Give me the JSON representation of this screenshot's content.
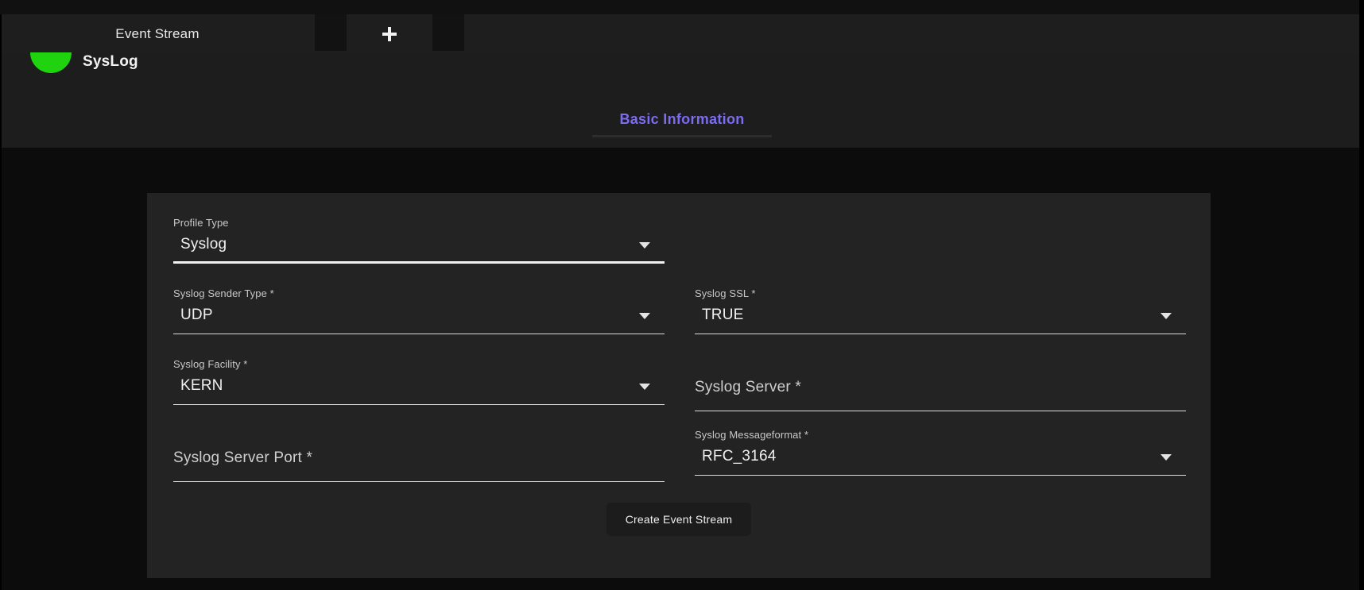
{
  "window": {
    "tab_bar": {
      "tabs": [
        {
          "label": "Event Stream",
          "name": "tab-event-stream"
        }
      ],
      "add_tab_icon": "plus-icon"
    }
  },
  "stream_header": {
    "status_icon": "half-circle-status-icon",
    "status_color": "#1fd40f",
    "name": "SysLog",
    "tabs": [
      {
        "label": "Basic Information",
        "active": true
      }
    ],
    "accent_color": "#7b6cf0"
  },
  "form": {
    "rows": [
      {
        "left": {
          "type": "select",
          "label": "Profile Type",
          "value": "Syslog",
          "filled": true,
          "caret": "chevron-down-icon"
        },
        "right": null
      },
      {
        "left": {
          "type": "select",
          "label": "Syslog Sender Type *",
          "value": "UDP",
          "filled": true,
          "caret": "chevron-down-icon"
        },
        "right": {
          "type": "select",
          "label": "Syslog SSL *",
          "value": "TRUE",
          "filled": true,
          "caret": "chevron-down-icon"
        }
      },
      {
        "left": {
          "type": "select",
          "label": "Syslog Facility *",
          "value": "KERN",
          "filled": true,
          "caret": "chevron-down-icon"
        },
        "right": {
          "type": "text",
          "label": "",
          "placeholder": "Syslog Server *",
          "value": "",
          "filled": false
        }
      },
      {
        "left": {
          "type": "text",
          "label": "",
          "placeholder": "Syslog Server Port *",
          "value": "",
          "filled": false
        },
        "right": {
          "type": "select",
          "label": "Syslog Messageformat *",
          "value": "RFC_3164",
          "filled": true,
          "caret": "chevron-down-icon"
        }
      }
    ],
    "submit_label": "Create Event Stream"
  }
}
